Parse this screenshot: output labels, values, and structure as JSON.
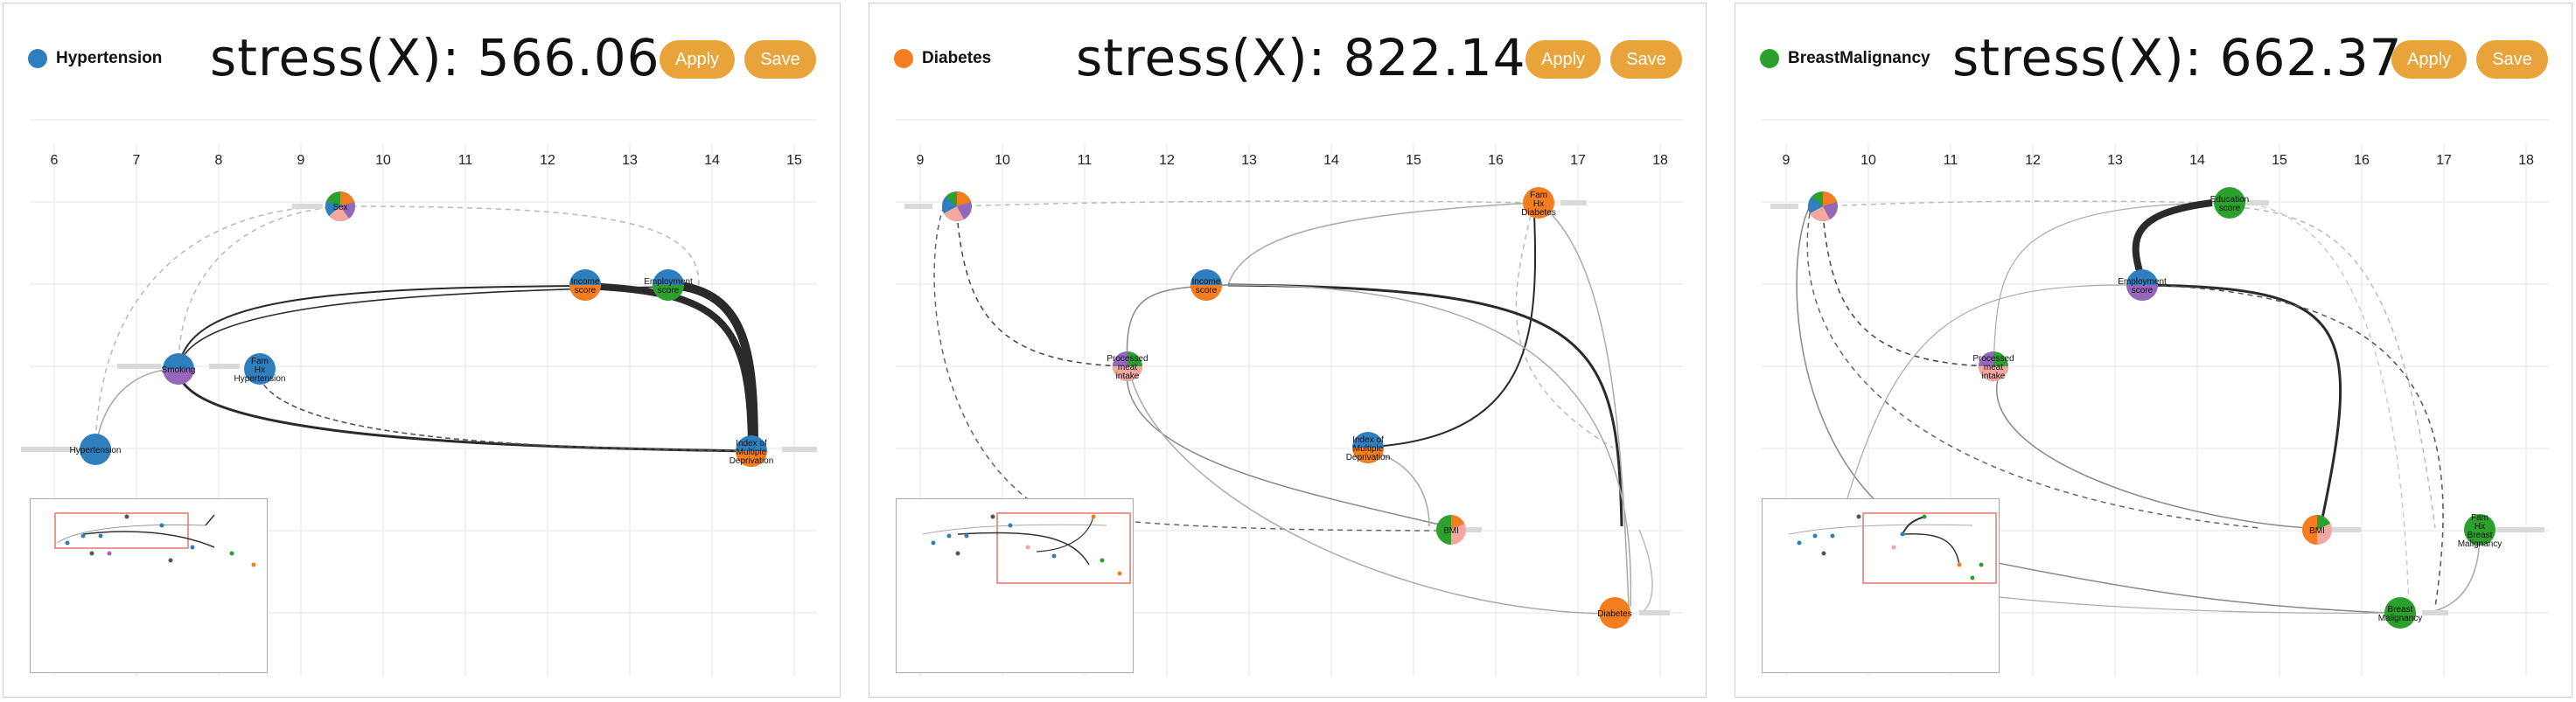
{
  "colors": {
    "blue": "#2f7fbf",
    "orange": "#f47d20",
    "green": "#2ca02c",
    "purple": "#9467bd",
    "pink": "#f4a6a0",
    "button": "#e8a33a",
    "edge_dark": "#2a2a2a",
    "edge_light": "#aaaaaa",
    "grid": "#e6e6e6",
    "viewport": "#e8756a"
  },
  "panels": [
    {
      "legend": {
        "label": "Hypertension",
        "color": "#2f7fbf"
      },
      "stress_text": "stress(X):  566.06",
      "apply_label": "Apply",
      "save_label": "Save",
      "ticks": [
        "6",
        "7",
        "8",
        "9",
        "10",
        "11",
        "12",
        "13",
        "14",
        "15"
      ],
      "node_labels": {
        "smoking": "Smoking",
        "family_hx": "Fam\nHx\nHypertension",
        "income": "Income\nscore",
        "employment": "Employment\nscore",
        "imd": "Index of\nMultiple\nDeprivation",
        "hypertension": "Hypertension",
        "top": "Sex"
      }
    },
    {
      "legend": {
        "label": "Diabetes",
        "color": "#f47d20"
      },
      "stress_text": "stress(X):  822.14",
      "apply_label": "Apply",
      "save_label": "Save",
      "ticks": [
        "9",
        "10",
        "11",
        "12",
        "13",
        "14",
        "15",
        "16",
        "17",
        "18"
      ],
      "node_labels": {
        "fam": "Fam\nHx\nDiabetes",
        "income": "Income\nscore",
        "processed": "Processed\nmeat\nintake",
        "imd": "Index of\nMultiple\nDeprivation",
        "bmi": "BMI",
        "diabetes": "Diabetes"
      }
    },
    {
      "legend": {
        "label": "BreastMalignancy",
        "color": "#2ca02c"
      },
      "stress_text": "stress(X):  662.37",
      "apply_label": "Apply",
      "save_label": "Save",
      "ticks": [
        "9",
        "10",
        "11",
        "12",
        "13",
        "14",
        "15",
        "16",
        "17",
        "18"
      ],
      "node_labels": {
        "education": "Education\nscore",
        "employment": "Employment\nscore",
        "processed": "Processed\nmeat\nintake",
        "bmi": "BMI",
        "famhx": "Fam\nHx\nBreast\nMalignancy",
        "breast": "Breast\nMalignancy"
      }
    }
  ]
}
